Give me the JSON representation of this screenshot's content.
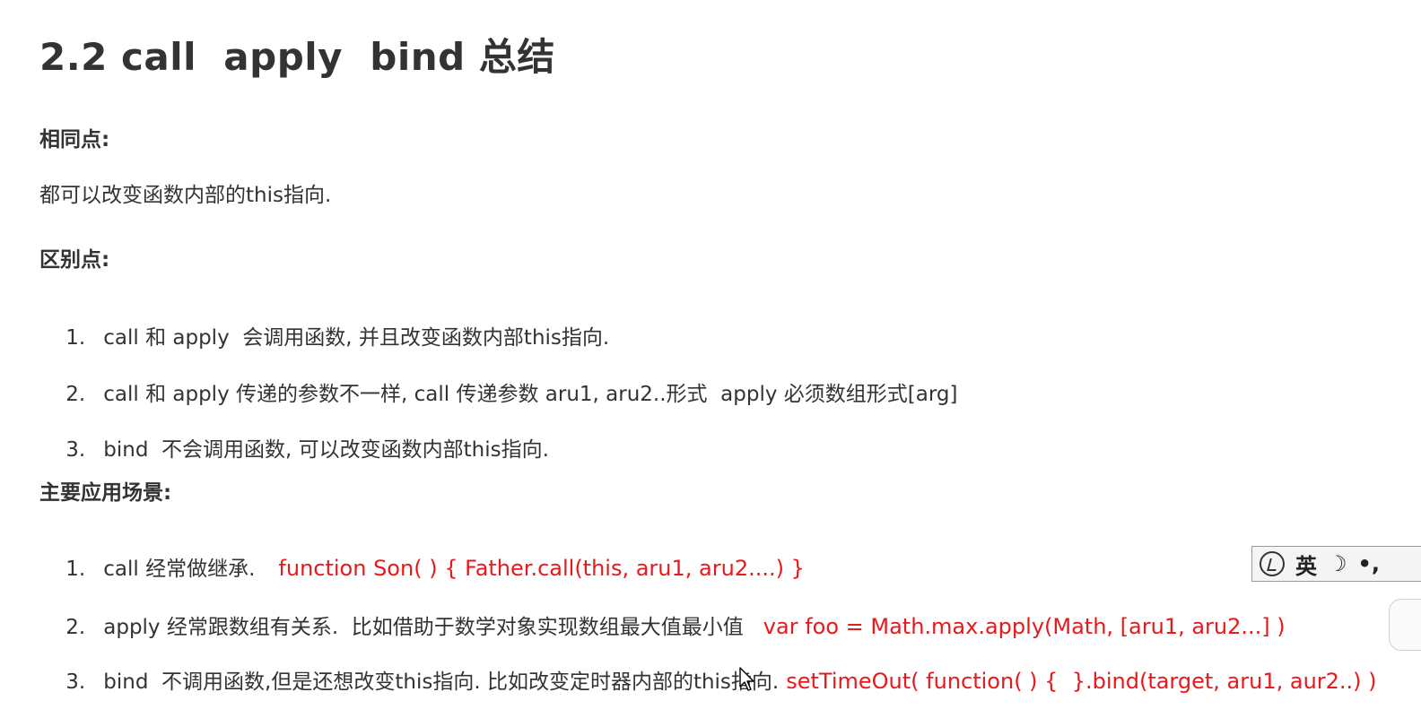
{
  "title": "2.2 call  apply  bind 总结",
  "same": {
    "heading": "相同点:",
    "text": "都可以改变函数内部的this指向."
  },
  "diff": {
    "heading": "区别点:",
    "items": [
      {
        "num": "1.",
        "text": "call 和 apply  会调用函数, 并且改变函数内部this指向."
      },
      {
        "num": "2.",
        "text": "call 和 apply 传递的参数不一样, call 传递参数 aru1, aru2..形式  apply 必须数组形式[arg]"
      },
      {
        "num": "3.",
        "text": "bind  不会调用函数, 可以改变函数内部this指向."
      }
    ]
  },
  "usage": {
    "heading": "主要应用场景:",
    "items": [
      {
        "num": "1.",
        "text": "call 经常做继承.",
        "code": "function Son( ) { Father.call(this, aru1, aru2....) }"
      },
      {
        "num": "2.",
        "text": "apply 经常跟数组有关系.  比如借助于数学对象实现数组最大值最小值",
        "code": "var foo = Math.max.apply(Math, [aru1, aru2...] )"
      },
      {
        "num": "3.",
        "text": "bind  不调用函数,但是还想改变this指向. 比如改变定时器内部的this指向.",
        "code": "setTimeOut( function( ) {  }.bind(target, aru1, aur2..) )"
      }
    ]
  },
  "ime": {
    "lang": "英",
    "moon": "☽",
    "punct": "•,"
  },
  "colors": {
    "text": "#333333",
    "code": "#e8191c"
  },
  "icons": [
    "ime-logo-icon",
    "moon-icon",
    "punctuation-icon",
    "mouse-cursor-icon"
  ]
}
